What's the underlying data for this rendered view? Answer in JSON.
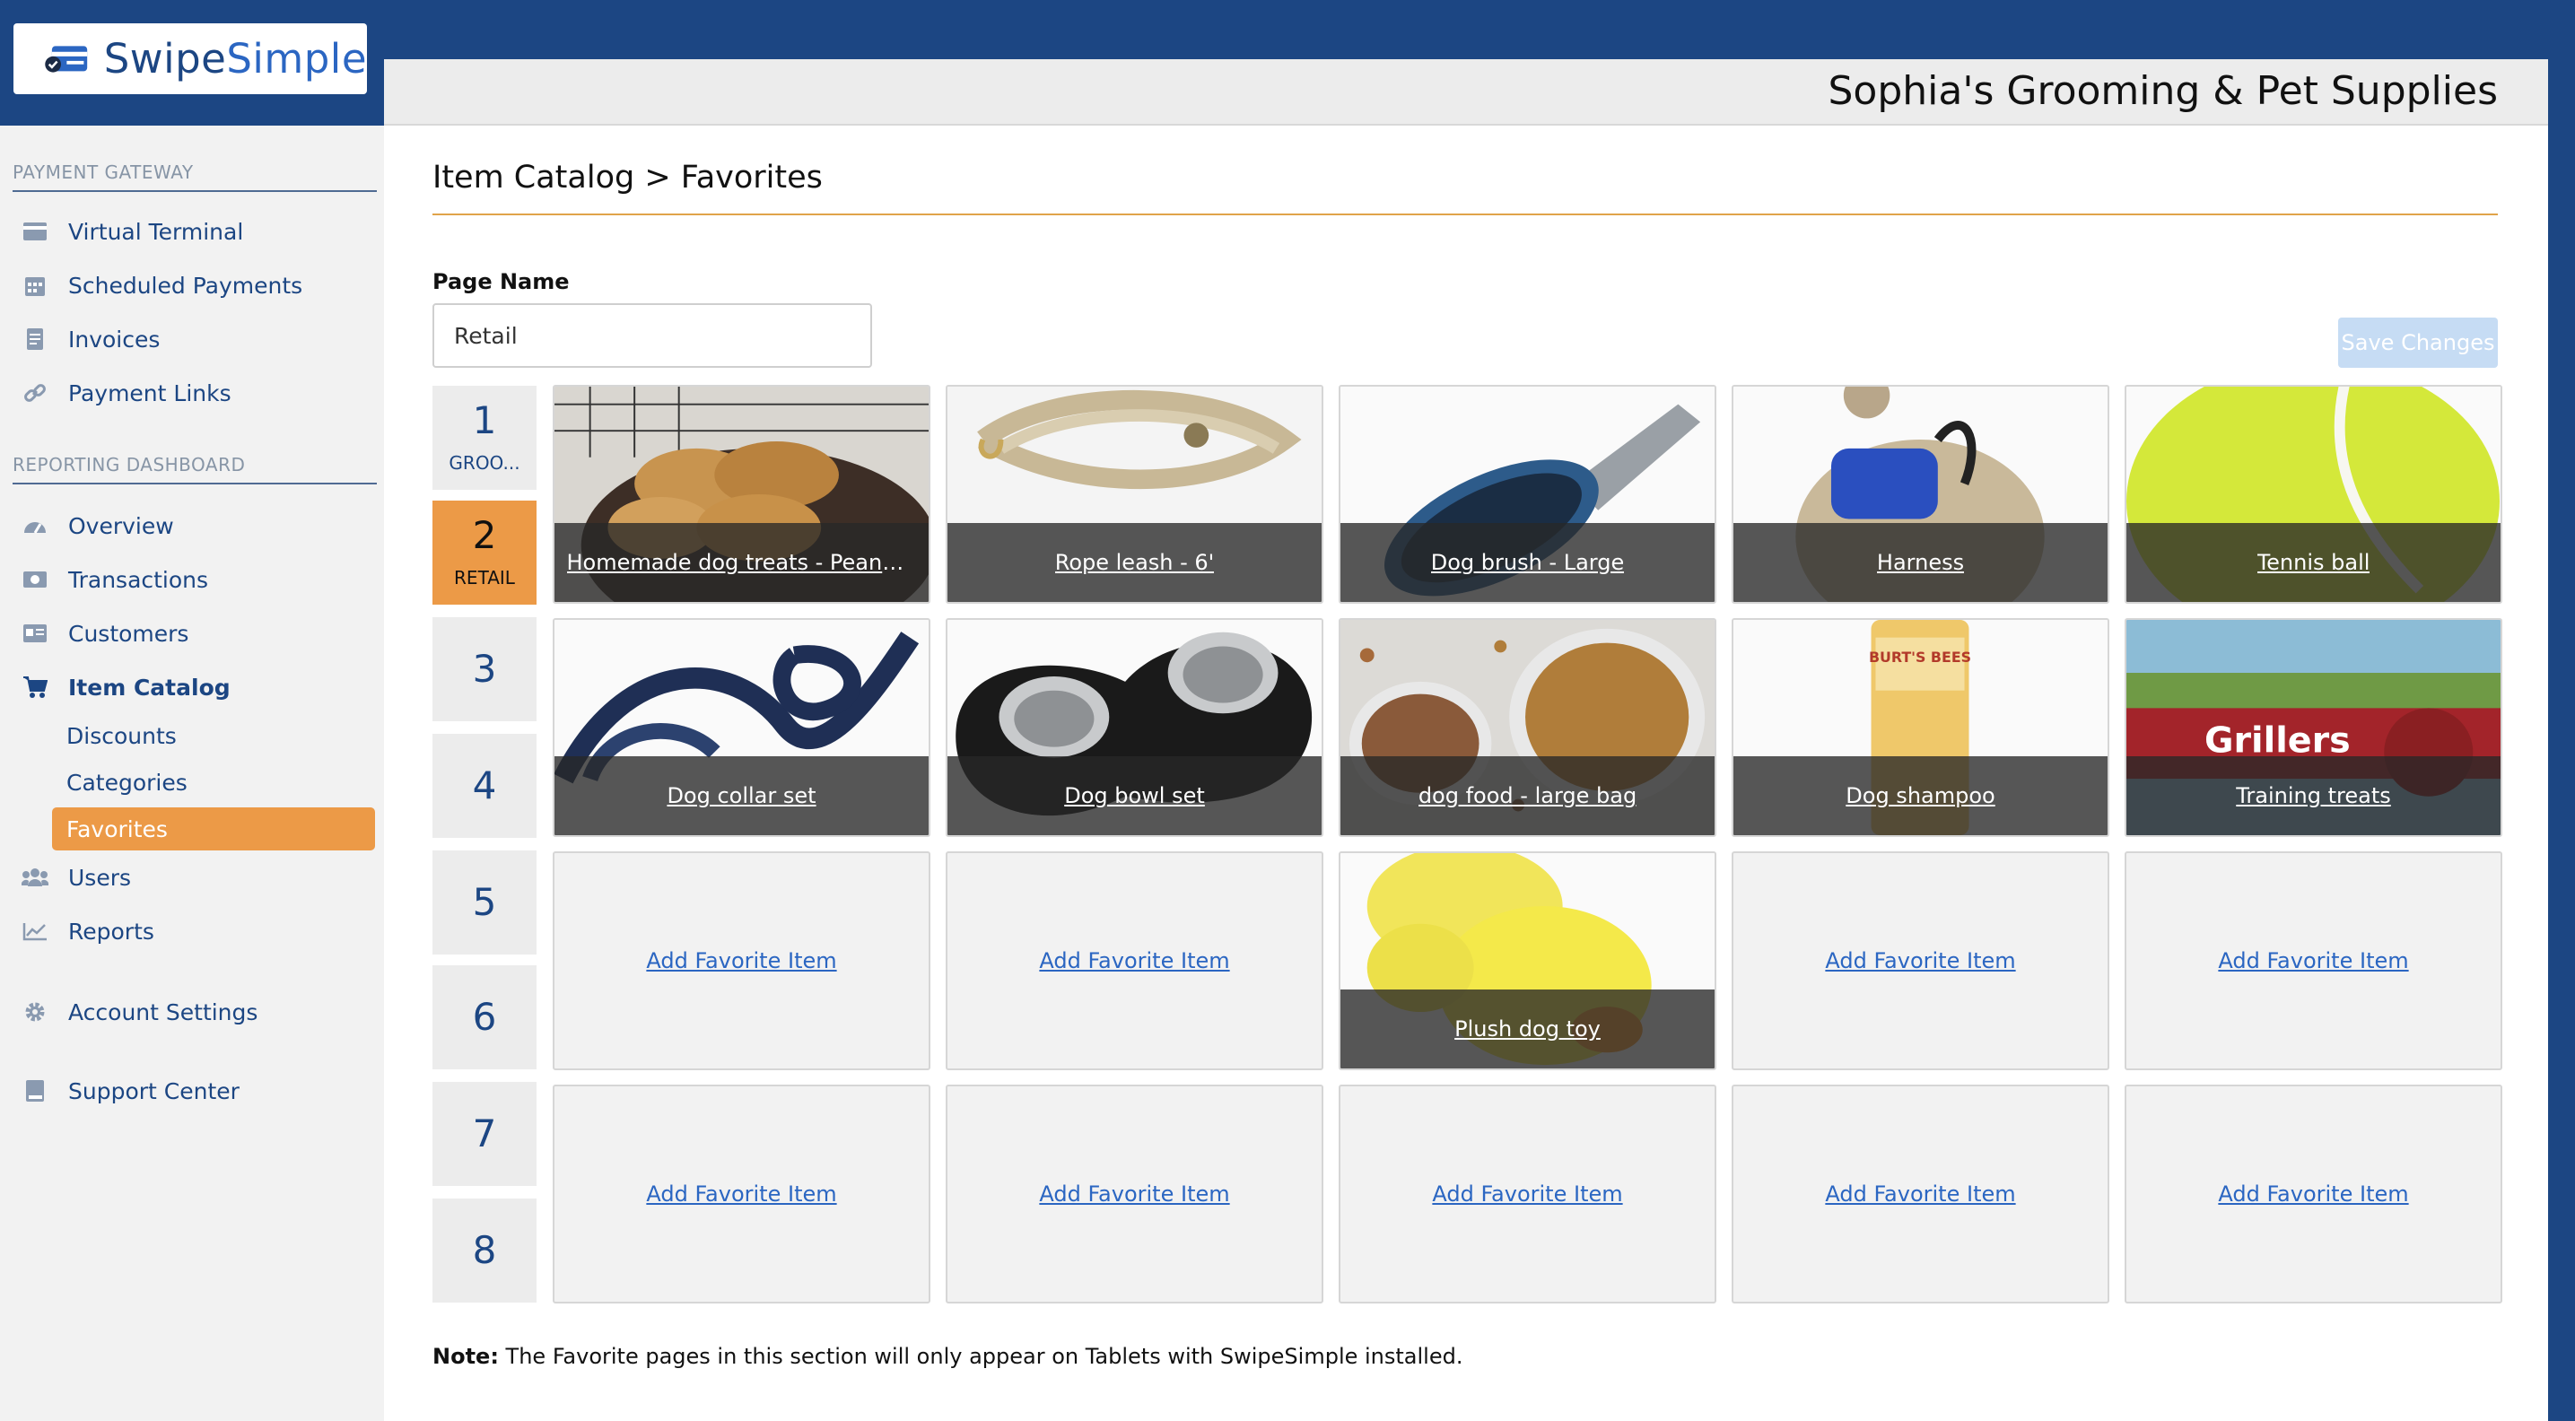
{
  "brand": {
    "name_a": "Swipe",
    "name_b": "Simple"
  },
  "sidebar": {
    "sections": [
      {
        "label": "PAYMENT GATEWAY"
      },
      {
        "label": "REPORTING DASHBOARD"
      }
    ],
    "items": [
      {
        "label": "Virtual Terminal",
        "icon": "credit-card-icon"
      },
      {
        "label": "Scheduled Payments",
        "icon": "calendar-icon"
      },
      {
        "label": "Invoices",
        "icon": "invoice-icon"
      },
      {
        "label": "Payment Links",
        "icon": "link-icon"
      },
      {
        "label": "Overview",
        "icon": "dashboard-icon"
      },
      {
        "label": "Transactions",
        "icon": "money-icon"
      },
      {
        "label": "Customers",
        "icon": "id-card-icon"
      },
      {
        "label": "Item Catalog",
        "icon": "cart-icon"
      },
      {
        "label": "Users",
        "icon": "users-icon"
      },
      {
        "label": "Reports",
        "icon": "chart-icon"
      },
      {
        "label": "Account Settings",
        "icon": "gear-icon"
      },
      {
        "label": "Support Center",
        "icon": "book-icon"
      }
    ],
    "sub_items": [
      {
        "label": "Discounts"
      },
      {
        "label": "Categories"
      },
      {
        "label": "Favorites"
      }
    ]
  },
  "header": {
    "business_name": "Sophia's Grooming & Pet Supplies"
  },
  "main": {
    "breadcrumb": "Item Catalog > Favorites",
    "page_name_label": "Page Name",
    "page_name_value": "Retail",
    "save_label": "Save Changes",
    "pages": [
      {
        "num": "1",
        "label": "GROO..."
      },
      {
        "num": "2",
        "label": "RETAIL"
      },
      {
        "num": "3",
        "label": ""
      },
      {
        "num": "4",
        "label": ""
      },
      {
        "num": "5",
        "label": ""
      },
      {
        "num": "6",
        "label": ""
      },
      {
        "num": "7",
        "label": ""
      },
      {
        "num": "8",
        "label": ""
      }
    ],
    "tiles": [
      {
        "label": "Homemade dog treats - Peanut ..."
      },
      {
        "label": "Rope leash - 6'"
      },
      {
        "label": "Dog brush - Large"
      },
      {
        "label": "Harness"
      },
      {
        "label": "Tennis ball"
      },
      {
        "label": "Dog collar set"
      },
      {
        "label": "Dog bowl set"
      },
      {
        "label": "dog food - large bag"
      },
      {
        "label": "Dog shampoo"
      },
      {
        "label": "Training treats"
      },
      {
        "label": "Add Favorite Item"
      },
      {
        "label": "Add Favorite Item"
      },
      {
        "label": "Plush dog toy"
      },
      {
        "label": "Add Favorite Item"
      },
      {
        "label": "Add Favorite Item"
      },
      {
        "label": "Add Favorite Item"
      },
      {
        "label": "Add Favorite Item"
      },
      {
        "label": "Add Favorite Item"
      },
      {
        "label": "Add Favorite Item"
      },
      {
        "label": "Add Favorite Item"
      }
    ],
    "artwork_text": {
      "shampoo_brand": "BURT'S BEES",
      "treats_brand": "Grillers"
    },
    "note_bold": "Note:",
    "note_text": " The Favorite pages in this section will only appear on Tablets with SwipeSimple installed."
  },
  "colors": {
    "brand_blue": "#1c4683",
    "accent_orange": "#ec9a47",
    "link_blue": "#2b66c2"
  }
}
